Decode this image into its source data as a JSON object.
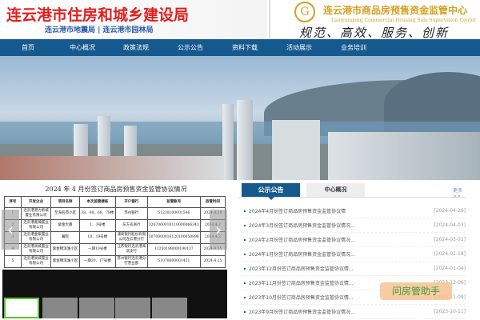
{
  "header": {
    "title": "连云港市住房和城乡建设局",
    "subtitle": "连云港市地震局 | 连云港市园林局",
    "center_name": "连云港市商品房预售资金监管中心",
    "center_en": "Lianyungang Commercial Housing Sale Supervision Center",
    "slogan": "规范、高效、服务、创新",
    "logo_glyph": "G"
  },
  "nav": [
    "首页",
    "中心概况",
    "政策法规",
    "公示公告",
    "资料下载",
    "活动展示",
    "业务培训"
  ],
  "table": {
    "title": "2024 年 4 月份签订商品房预售资金监管协议情况",
    "headers": [
      "序号",
      "开发企业",
      "项目名称",
      "本次监管楼栋",
      "开户银行",
      "监管账号",
      "监管时间"
    ],
    "rows": [
      [
        "1",
        "连云港港力新城置业有限公司",
        "至海名苑小区",
        "38、48、68、78楼",
        "苏州银行",
        "51220100001546",
        "2024.4.18"
      ],
      [
        "2",
        "连云港嘉瀚置业有限公司",
        "紫金大厦",
        "1、3号楼",
        "东方农商行",
        "3207060018110000066343",
        "2024.4.2"
      ],
      [
        "3",
        "连云港金紫置业有限公司",
        "翼院",
        "18、19号楼",
        "浦商银行股份有限公司连云港分行",
        "5070000016120100050896",
        "2024.4.2"
      ],
      [
        "4",
        "连云港润城置业有限公司",
        "紫金锦滨湖小区",
        "一期10号楼",
        "江苏银行连云港海滨支行",
        "11250188000190137",
        "2024.4.25"
      ],
      [
        "5",
        "连云港润城置业有限公司",
        "紫金锦滨湖小区",
        "一期20、17号楼",
        "苏州银行连云港分行营业部",
        "51070600001451",
        "2024.4.25"
      ]
    ]
  },
  "slider": {
    "prev": "‹",
    "next": "›"
  },
  "tabs": {
    "active": "公示公告",
    "other": "中心概况",
    "more": "更多>>"
  },
  "news": [
    {
      "title": "2024年4月份签订商品房预售资金监管协议情",
      "date": "[2024-04-29]"
    },
    {
      "title": "2024年3月份签订商品房预售资金监管协议情况...",
      "date": "[2024-04-03]"
    },
    {
      "title": "2024年2月份签订商品房预售资金监管协议情况...",
      "date": "[2024-03-01]"
    },
    {
      "title": "2024年1月份签订商品房预售资金监管协议情况...",
      "date": "[2024-02-18]"
    },
    {
      "title": "2023年12月份签订商品房预售资金监管协议情...",
      "date": "[2024-01-04]"
    },
    {
      "title": "2023年11月份签订商品房预售资金监管协议情...",
      "date": "[2023-12-06]"
    },
    {
      "title": "2023年10月份签订商品房预售资金监管协议情...",
      "date": "[2023-11-09]"
    },
    {
      "title": "2023年9月份签订商品房预售资金监管协议情况...",
      "date": "[2023-10-11]"
    }
  ],
  "watermark": "问房管助手",
  "colors": {
    "nav": "#16598f",
    "title_red": "#e02020",
    "gold": "#d4a020"
  }
}
